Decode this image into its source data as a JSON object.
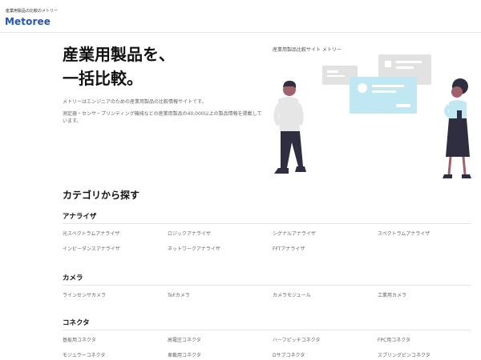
{
  "header": {
    "tagline": "産業用製品の比較のメトリー",
    "logo": "Metoree"
  },
  "hero": {
    "title_line1": "産業用製品を、",
    "title_line2": "一括比較。",
    "desc1": "メトリーはエンジニアのための産業用製品の比較情報サイトです。",
    "desc2": "測定器・センサ・プリンティング機械などの産業用製品の40,000以上の製品情報を掲載しています。",
    "caption": "産業用製品比較サイト メトリー"
  },
  "categories_section": {
    "title": "カテゴリから探す",
    "categories": [
      {
        "name": "アナライザ",
        "items": [
          "光スペクトラムアナライザ",
          "ロジックアナライザ",
          "シグナルアナライザ",
          "スペクトラムアナライザ",
          "インピーダンスアナライザ",
          "ネットワークアナライザ",
          "FFTアナライザ"
        ]
      },
      {
        "name": "カメラ",
        "items": [
          "ラインセンサカメラ",
          "ToFカメラ",
          "カメラモジュール",
          "工業用カメラ"
        ]
      },
      {
        "name": "コネクタ",
        "items": [
          "基板用コネクタ",
          "高電圧コネクタ",
          "ハーフピッチコネクタ",
          "FPC用コネクタ",
          "モジュラーコネクタ",
          "車載用コネクタ",
          "Dサブコネクタ",
          "スプリングピンコネクタ"
        ]
      }
    ]
  },
  "colors": {
    "brand": "#1e54c6",
    "card_accent": "#bfe8f3",
    "card_grey": "#e2e2e2"
  }
}
